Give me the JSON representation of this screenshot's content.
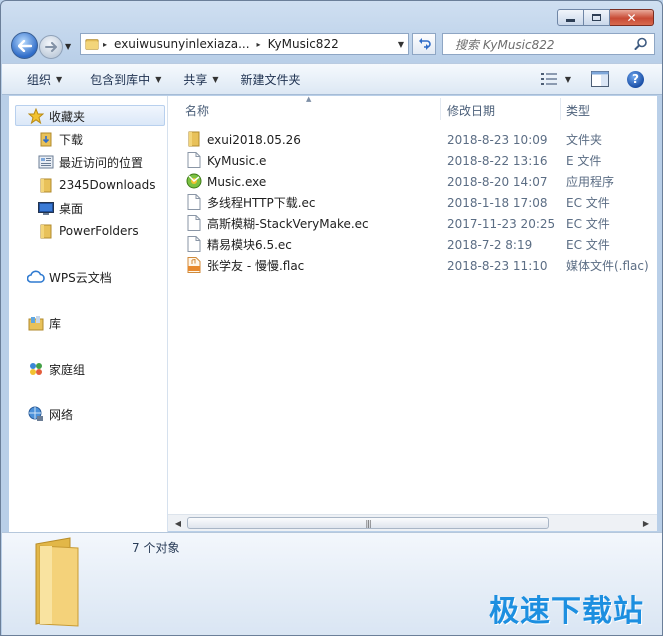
{
  "window": {
    "caption_close": "✕"
  },
  "address": {
    "segments": [
      "exuiwusunyinlexiaza...",
      "KyMusic822"
    ],
    "separator": "▸"
  },
  "search": {
    "placeholder": "搜索 KyMusic822"
  },
  "toolbar": {
    "organize": "组织",
    "include_in_library": "包含到库中",
    "share": "共享",
    "new_folder": "新建文件夹",
    "help": "?"
  },
  "nav": {
    "favorites": "收藏夹",
    "downloads": "下载",
    "recent": "最近访问的位置",
    "downloads2345": "2345Downloads",
    "desktop": "桌面",
    "powerfolders": "PowerFolders",
    "wps": "WPS云文档",
    "library": "库",
    "homegroup": "家庭组",
    "network": "网络"
  },
  "columns": {
    "name": "名称",
    "date": "修改日期",
    "type": "类型"
  },
  "files": [
    {
      "name": "exui2018.05.26",
      "date": "2018-8-23 10:09",
      "type": "文件夹",
      "icon": "folder-icon"
    },
    {
      "name": "KyMusic.e",
      "date": "2018-8-22 13:16",
      "type": "E 文件",
      "icon": "file-icon"
    },
    {
      "name": "Music.exe",
      "date": "2018-8-20 14:07",
      "type": "应用程序",
      "icon": "music-app-icon"
    },
    {
      "name": "多线程HTTP下载.ec",
      "date": "2018-1-18 17:08",
      "type": "EC 文件",
      "icon": "file-icon"
    },
    {
      "name": "高斯模糊-StackVeryMake.ec",
      "date": "2017-11-23 20:25",
      "type": "EC 文件",
      "icon": "file-icon"
    },
    {
      "name": "精易模块6.5.ec",
      "date": "2018-7-2 8:19",
      "type": "EC 文件",
      "icon": "file-icon"
    },
    {
      "name": "张学友 - 慢慢.flac",
      "date": "2018-8-23 11:10",
      "type": "媒体文件(.flac)",
      "icon": "flac-icon"
    }
  ],
  "details": {
    "count": "7 个对象"
  },
  "watermark": "极速下载站",
  "colors": {
    "accent": "#1d8fe0",
    "folder": "#e8c15a"
  }
}
